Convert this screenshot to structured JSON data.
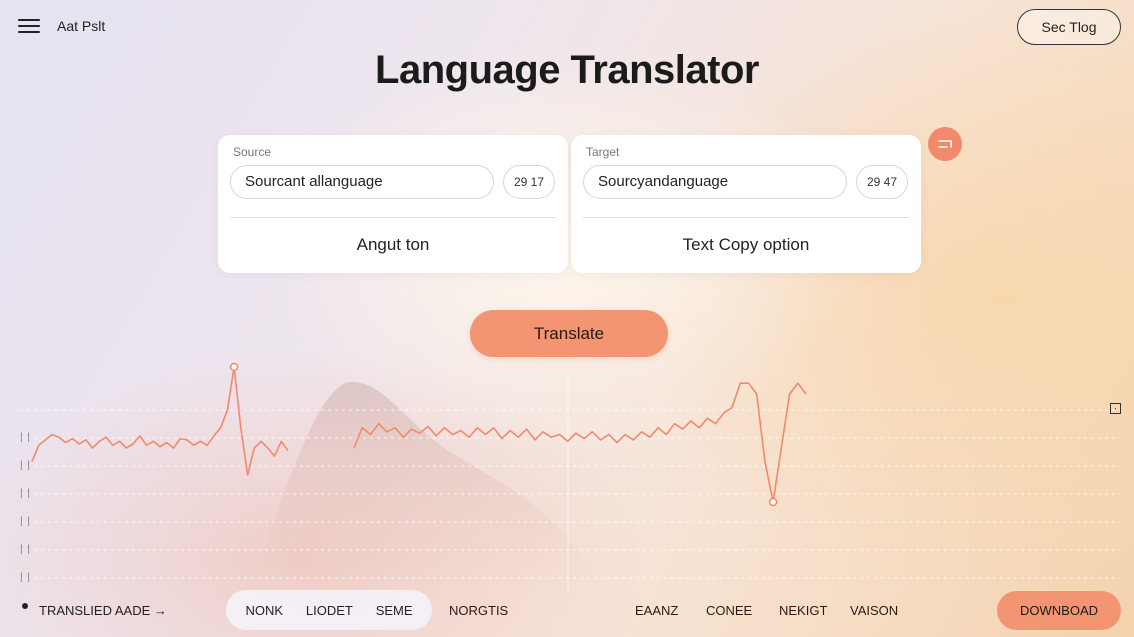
{
  "header": {
    "app_name": "Aat Pslt",
    "top_action": "Sec Tlog"
  },
  "page_title": "Language Translator",
  "source": {
    "label": "Source",
    "language_value": "Sourcant allanguage",
    "count": "29  17",
    "body_text": "Angut ton"
  },
  "target": {
    "label": "Target",
    "language_value": "Sourcyandanguage",
    "count": "29  47",
    "body_text": "Text Copy option"
  },
  "swap_icon": "swap-icon",
  "translate_label": "Translate",
  "chart_data": {
    "type": "line",
    "y_tick_labels": [
      "| |",
      "| |",
      "| |",
      "| |",
      "| |",
      "| |"
    ],
    "grid": true,
    "series": [
      {
        "values": [
          0.3,
          0.42,
          0.46,
          0.5,
          0.48,
          0.44,
          0.47,
          0.43,
          0.46,
          0.4,
          0.45,
          0.48,
          0.42,
          0.45,
          0.4,
          0.43,
          0.49,
          0.42,
          0.45,
          0.41,
          0.44,
          0.4,
          0.47,
          0.46,
          0.42,
          0.45,
          0.42,
          0.49,
          0.55,
          0.68,
          1.0,
          0.55,
          0.2,
          0.4,
          0.45,
          0.4,
          0.34,
          0.45,
          0.38
        ]
      },
      {
        "values": [
          0.4,
          0.55,
          0.5,
          0.58,
          0.52,
          0.55,
          0.48,
          0.54,
          0.51,
          0.56,
          0.49,
          0.55,
          0.5,
          0.53,
          0.48,
          0.55,
          0.5,
          0.55,
          0.47,
          0.53,
          0.48,
          0.54,
          0.46,
          0.52,
          0.48,
          0.5,
          0.45,
          0.51,
          0.47,
          0.52,
          0.46,
          0.5,
          0.44,
          0.5,
          0.46,
          0.52,
          0.48,
          0.55,
          0.5,
          0.58,
          0.54,
          0.6,
          0.55,
          0.62,
          0.58,
          0.66,
          0.7,
          0.88,
          0.88,
          0.8,
          0.3,
          0.0,
          0.4,
          0.8,
          0.88,
          0.8
        ]
      }
    ]
  },
  "bottom": {
    "left_label": "TRANSLIED AADE →",
    "segments": [
      "NONK",
      "LIODET",
      "SEME"
    ],
    "links": [
      "NORGTIS",
      "EAANZ",
      "CONEE",
      "NEKIGT",
      "VAISON"
    ],
    "download_label": "DOWNBOAD"
  },
  "colors": {
    "accent": "#f39572",
    "line": "#f08a6d"
  }
}
